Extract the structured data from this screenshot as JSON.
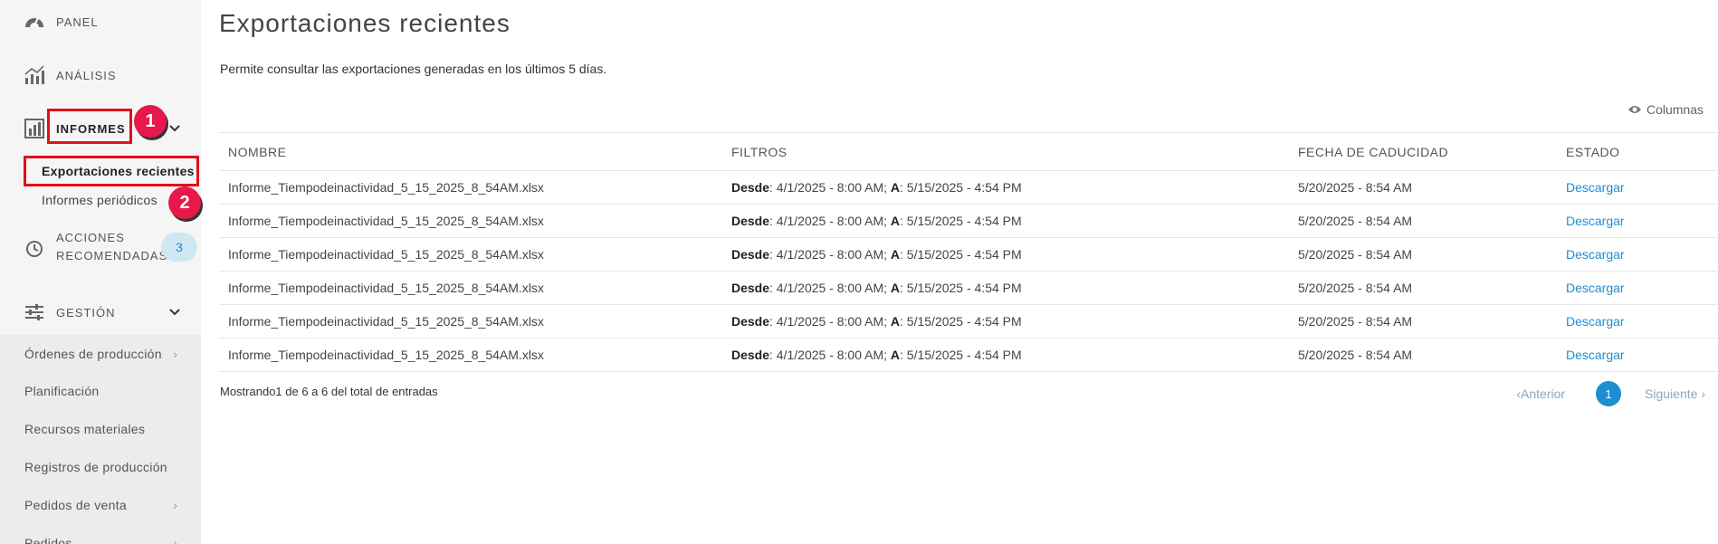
{
  "sidebar": {
    "panel": "PANEL",
    "analisis": "ANÁLISIS",
    "informes": "INFORMES",
    "informes_sub": [
      "Exportaciones recientes",
      "Informes periódicos"
    ],
    "acciones_line1": "ACCIONES",
    "acciones_line2": "RECOMENDADAS",
    "acciones_badge": "3",
    "gestion": "GESTIÓN",
    "gestion_items": [
      "Órdenes de producción",
      "Planificación",
      "Recursos materiales",
      "Registros de producción",
      "Pedidos de venta",
      "Pedidos"
    ]
  },
  "markers": [
    "1",
    "2"
  ],
  "main": {
    "title": "Exportaciones recientes",
    "description": "Permite consultar las exportaciones generadas en los últimos 5 días.",
    "columns_btn": "Columnas",
    "table": {
      "headers": [
        "NOMBRE",
        "FILTROS",
        "FECHA DE CADUCIDAD",
        "ESTADO"
      ],
      "rows": [
        {
          "name": "Informe_Tiempodeinactividad_5_15_2025_8_54AM.xlsx",
          "desde_label": "Desde",
          "desde": ": 4/1/2025 - 8:00 AM; ",
          "a_label": "A",
          "a": ": 5/15/2025 - 4:54 PM",
          "caducidad": "5/20/2025 - 8:54 AM",
          "estado": "Descargar"
        },
        {
          "name": "Informe_Tiempodeinactividad_5_15_2025_8_54AM.xlsx",
          "desde_label": "Desde",
          "desde": ": 4/1/2025 - 8:00 AM; ",
          "a_label": "A",
          "a": ": 5/15/2025 - 4:54 PM",
          "caducidad": "5/20/2025 - 8:54 AM",
          "estado": "Descargar"
        },
        {
          "name": "Informe_Tiempodeinactividad_5_15_2025_8_54AM.xlsx",
          "desde_label": "Desde",
          "desde": ": 4/1/2025 - 8:00 AM; ",
          "a_label": "A",
          "a": ": 5/15/2025 - 4:54 PM",
          "caducidad": "5/20/2025 - 8:54 AM",
          "estado": "Descargar"
        },
        {
          "name": "Informe_Tiempodeinactividad_5_15_2025_8_54AM.xlsx",
          "desde_label": "Desde",
          "desde": ": 4/1/2025 - 8:00 AM; ",
          "a_label": "A",
          "a": ": 5/15/2025 - 4:54 PM",
          "caducidad": "5/20/2025 - 8:54 AM",
          "estado": "Descargar"
        },
        {
          "name": "Informe_Tiempodeinactividad_5_15_2025_8_54AM.xlsx",
          "desde_label": "Desde",
          "desde": ": 4/1/2025 - 8:00 AM; ",
          "a_label": "A",
          "a": ": 5/15/2025 - 4:54 PM",
          "caducidad": "5/20/2025 - 8:54 AM",
          "estado": "Descargar"
        },
        {
          "name": "Informe_Tiempodeinactividad_5_15_2025_8_54AM.xlsx",
          "desde_label": "Desde",
          "desde": ": 4/1/2025 - 8:00 AM; ",
          "a_label": "A",
          "a": ": 5/15/2025 - 4:54 PM",
          "caducidad": "5/20/2025 - 8:54 AM",
          "estado": "Descargar"
        }
      ]
    },
    "footer": "Mostrando1 de 6 a 6 del total de entradas",
    "pager": {
      "prev": "Anterior",
      "current": "1",
      "next": "Siguiente"
    }
  },
  "colors": {
    "accent": "#1e8ed1",
    "highlight": "#e0101a",
    "marker": "#e8184a"
  },
  "icons": [
    "gauge-icon",
    "analytics-icon",
    "bar-chart-icon",
    "history-icon",
    "sliders-icon",
    "eye-icon"
  ]
}
